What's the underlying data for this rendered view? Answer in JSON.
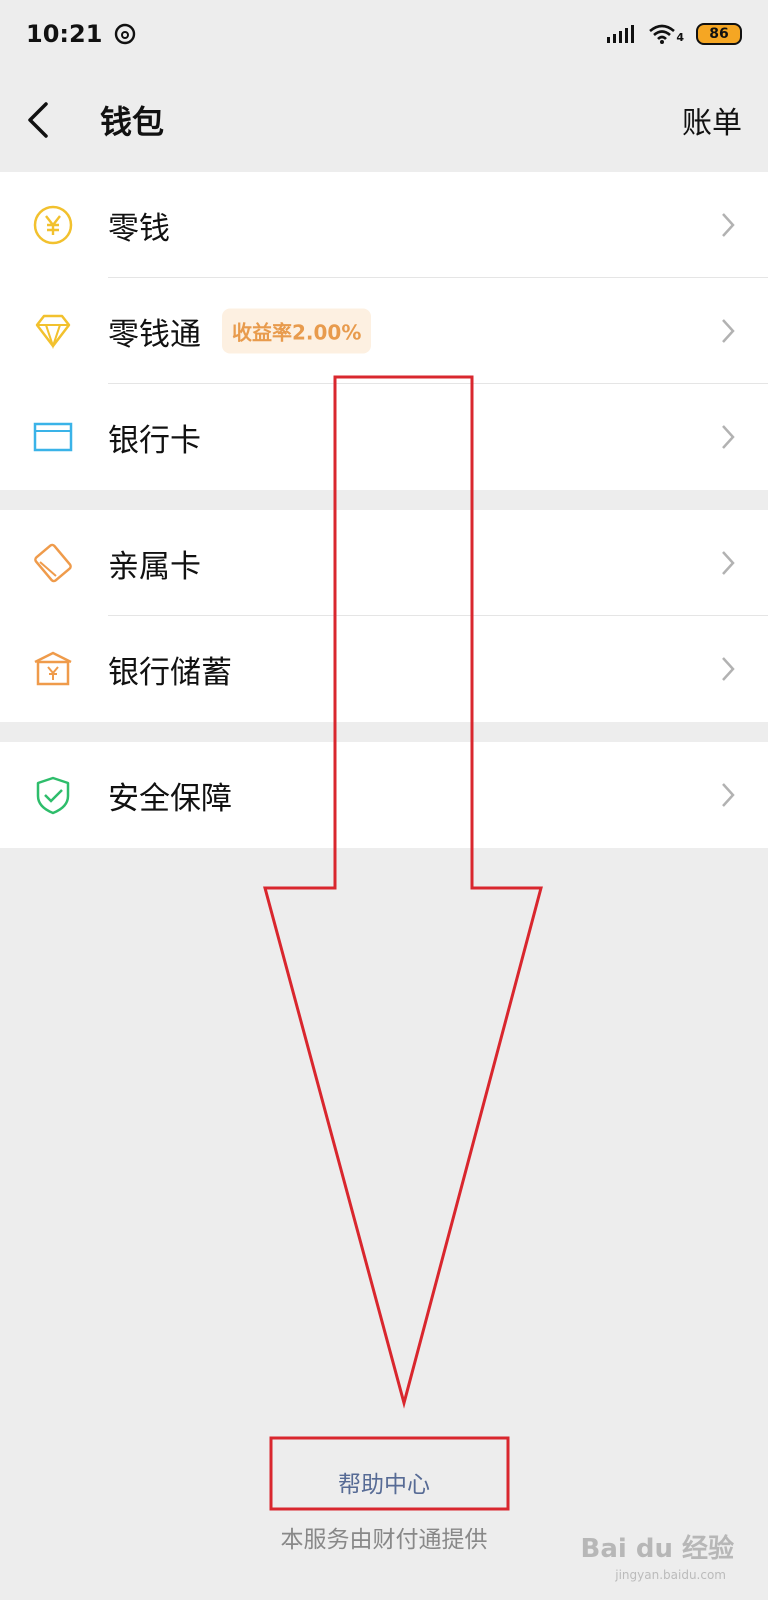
{
  "status_bar": {
    "time": "10:21",
    "network_label": "4",
    "battery": "86"
  },
  "header": {
    "title": "钱包",
    "action": "账单"
  },
  "menu": {
    "groups": [
      {
        "items": [
          {
            "label": "零钱",
            "icon": "yuan-coin-icon"
          },
          {
            "label": "零钱通",
            "icon": "diamond-icon",
            "tag": "收益率2.00%"
          },
          {
            "label": "银行卡",
            "icon": "bank-card-icon"
          }
        ]
      },
      {
        "items": [
          {
            "label": "亲属卡",
            "icon": "family-card-icon"
          },
          {
            "label": "银行储蓄",
            "icon": "bank-savings-icon"
          }
        ]
      },
      {
        "items": [
          {
            "label": "安全保障",
            "icon": "security-shield-icon"
          }
        ]
      }
    ]
  },
  "footer": {
    "help": "帮助中心",
    "provider": "本服务由财付通提供"
  },
  "watermark": {
    "text": "Bai du 经验",
    "sub": "jingyan.baidu.com"
  },
  "colors": {
    "background": "#ededed",
    "link": "#576b95",
    "annotation": "#d9272e",
    "tag_text": "#e89b4d",
    "tag_bg": "#fdf0e1"
  }
}
